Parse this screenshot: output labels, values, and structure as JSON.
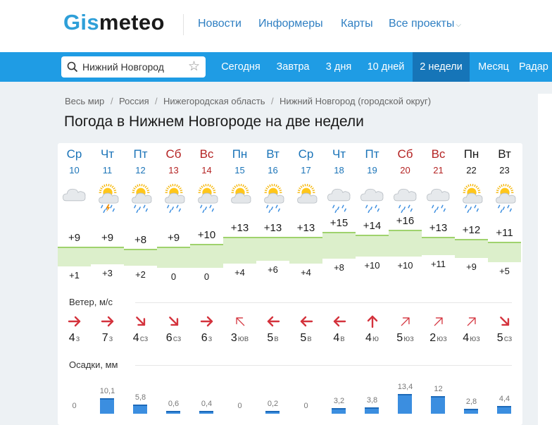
{
  "header": {
    "logo_gis": "Gis",
    "logo_meteo": "meteo",
    "nav": [
      "Новости",
      "Информеры",
      "Карты",
      "Все проекты"
    ]
  },
  "navbar": {
    "search_value": "Нижний Новгород",
    "tabs": [
      "Сегодня",
      "Завтра",
      "3 дня",
      "10 дней",
      "2 недели",
      "Месяц",
      "Радар"
    ],
    "active_tab": "2 недели"
  },
  "breadcrumb": [
    "Весь мир",
    "Россия",
    "Нижегородская область",
    "Нижний Новгород (городской округ)"
  ],
  "page_title": "Погода в Нижнем Новгороде на две недели",
  "labels": {
    "wind": "Ветер, м/с",
    "precip": "Осадки, мм"
  },
  "colors": {
    "accent": "#1f9ce4",
    "active_tab": "#1675b8",
    "weekend": "#b42323",
    "weekday": "#1b74b8",
    "temp_band": "#dcefcb",
    "precip_bar": "#3b8ee0"
  },
  "days": [
    {
      "dow": "Ср",
      "date": "10",
      "type": "weekday",
      "icon": "cloudy-icon",
      "tmax": "+9",
      "tmin": "+1",
      "wind": "4",
      "wind_dir": "з",
      "wind_arrow": "arrow-right-icon",
      "precip": "0"
    },
    {
      "dow": "Чт",
      "date": "11",
      "type": "weekday",
      "icon": "sun-cloud-rain-thunder-icon",
      "tmax": "+9",
      "tmin": "+3",
      "wind": "7",
      "wind_dir": "з",
      "wind_arrow": "arrow-right-icon",
      "precip": "10,1"
    },
    {
      "dow": "Пт",
      "date": "12",
      "type": "weekday",
      "icon": "sun-cloud-rain-icon",
      "tmax": "+8",
      "tmin": "+2",
      "wind": "4",
      "wind_dir": "сз",
      "wind_arrow": "arrow-down-right-icon",
      "precip": "5,8"
    },
    {
      "dow": "Сб",
      "date": "13",
      "type": "weekend",
      "icon": "sun-cloud-rain-icon",
      "tmax": "+9",
      "tmin": "0",
      "wind": "6",
      "wind_dir": "сз",
      "wind_arrow": "arrow-down-right-icon",
      "precip": "0,6"
    },
    {
      "dow": "Вс",
      "date": "14",
      "type": "weekend",
      "icon": "sun-cloud-rain-icon",
      "tmax": "+10",
      "tmin": "0",
      "wind": "6",
      "wind_dir": "з",
      "wind_arrow": "arrow-right-icon",
      "precip": "0,4"
    },
    {
      "dow": "Пн",
      "date": "15",
      "type": "weekday",
      "icon": "sun-cloud-icon",
      "tmax": "+13",
      "tmin": "+4",
      "wind": "3",
      "wind_dir": "юв",
      "wind_arrow": "arrow-up-left-icon",
      "precip": "0"
    },
    {
      "dow": "Вт",
      "date": "16",
      "type": "weekday",
      "icon": "sun-cloud-rain-icon",
      "tmax": "+13",
      "tmin": "+6",
      "wind": "5",
      "wind_dir": "в",
      "wind_arrow": "arrow-left-icon",
      "precip": "0,2"
    },
    {
      "dow": "Ср",
      "date": "17",
      "type": "weekday",
      "icon": "sun-cloud-icon",
      "tmax": "+13",
      "tmin": "+4",
      "wind": "5",
      "wind_dir": "в",
      "wind_arrow": "arrow-left-icon",
      "precip": "0"
    },
    {
      "dow": "Чт",
      "date": "18",
      "type": "weekday",
      "icon": "cloud-rain-icon",
      "tmax": "+15",
      "tmin": "+8",
      "wind": "4",
      "wind_dir": "в",
      "wind_arrow": "arrow-left-icon",
      "precip": "3,2"
    },
    {
      "dow": "Пт",
      "date": "19",
      "type": "weekday",
      "icon": "cloud-rain-icon",
      "tmax": "+14",
      "tmin": "+10",
      "wind": "4",
      "wind_dir": "ю",
      "wind_arrow": "arrow-up-icon",
      "precip": "3,8"
    },
    {
      "dow": "Сб",
      "date": "20",
      "type": "weekend",
      "icon": "cloud-rain-icon",
      "tmax": "+16",
      "tmin": "+10",
      "wind": "5",
      "wind_dir": "юз",
      "wind_arrow": "arrow-up-right-icon",
      "precip": "13,4"
    },
    {
      "dow": "Вс",
      "date": "21",
      "type": "weekend",
      "icon": "cloud-rain-icon",
      "tmax": "+13",
      "tmin": "+11",
      "wind": "2",
      "wind_dir": "юз",
      "wind_arrow": "arrow-up-right-icon",
      "precip": "12"
    },
    {
      "dow": "Пн",
      "date": "22",
      "type": "black",
      "icon": "sun-cloud-rain-icon",
      "tmax": "+12",
      "tmin": "+9",
      "wind": "4",
      "wind_dir": "юз",
      "wind_arrow": "arrow-up-right-icon",
      "precip": "2,8"
    },
    {
      "dow": "Вт",
      "date": "23",
      "type": "black",
      "icon": "sun-cloud-rain-icon",
      "tmax": "+11",
      "tmin": "+5",
      "wind": "5",
      "wind_dir": "сз",
      "wind_arrow": "arrow-down-right-icon",
      "precip": "4,4"
    }
  ]
}
